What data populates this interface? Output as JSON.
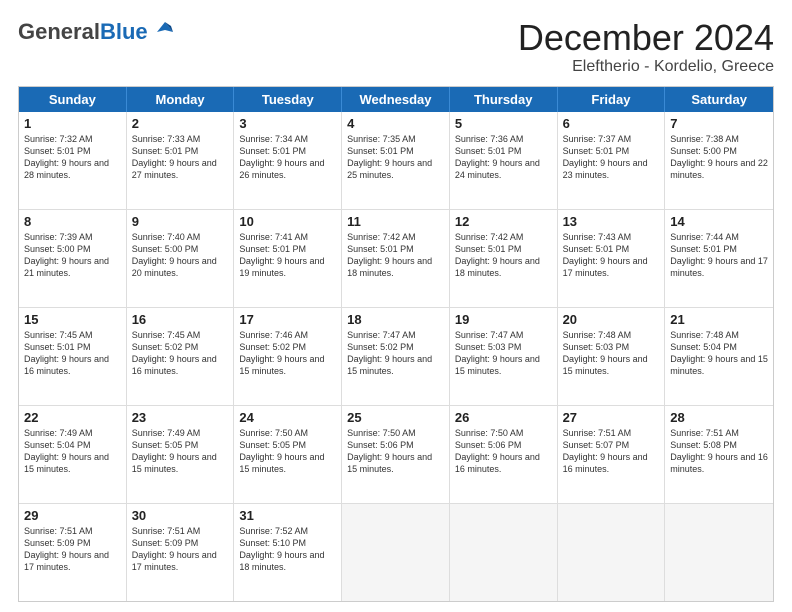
{
  "header": {
    "logo_general": "General",
    "logo_blue": "Blue",
    "title": "December 2024",
    "subtitle": "Eleftherio - Kordelio, Greece"
  },
  "calendar": {
    "days": [
      "Sunday",
      "Monday",
      "Tuesday",
      "Wednesday",
      "Thursday",
      "Friday",
      "Saturday"
    ],
    "rows": [
      [
        {
          "day": "1",
          "sunrise": "7:32 AM",
          "sunset": "5:01 PM",
          "daylight": "9 hours and 28 minutes."
        },
        {
          "day": "2",
          "sunrise": "7:33 AM",
          "sunset": "5:01 PM",
          "daylight": "9 hours and 27 minutes."
        },
        {
          "day": "3",
          "sunrise": "7:34 AM",
          "sunset": "5:01 PM",
          "daylight": "9 hours and 26 minutes."
        },
        {
          "day": "4",
          "sunrise": "7:35 AM",
          "sunset": "5:01 PM",
          "daylight": "9 hours and 25 minutes."
        },
        {
          "day": "5",
          "sunrise": "7:36 AM",
          "sunset": "5:01 PM",
          "daylight": "9 hours and 24 minutes."
        },
        {
          "day": "6",
          "sunrise": "7:37 AM",
          "sunset": "5:01 PM",
          "daylight": "9 hours and 23 minutes."
        },
        {
          "day": "7",
          "sunrise": "7:38 AM",
          "sunset": "5:00 PM",
          "daylight": "9 hours and 22 minutes."
        }
      ],
      [
        {
          "day": "8",
          "sunrise": "7:39 AM",
          "sunset": "5:00 PM",
          "daylight": "9 hours and 21 minutes."
        },
        {
          "day": "9",
          "sunrise": "7:40 AM",
          "sunset": "5:00 PM",
          "daylight": "9 hours and 20 minutes."
        },
        {
          "day": "10",
          "sunrise": "7:41 AM",
          "sunset": "5:01 PM",
          "daylight": "9 hours and 19 minutes."
        },
        {
          "day": "11",
          "sunrise": "7:42 AM",
          "sunset": "5:01 PM",
          "daylight": "9 hours and 18 minutes."
        },
        {
          "day": "12",
          "sunrise": "7:42 AM",
          "sunset": "5:01 PM",
          "daylight": "9 hours and 18 minutes."
        },
        {
          "day": "13",
          "sunrise": "7:43 AM",
          "sunset": "5:01 PM",
          "daylight": "9 hours and 17 minutes."
        },
        {
          "day": "14",
          "sunrise": "7:44 AM",
          "sunset": "5:01 PM",
          "daylight": "9 hours and 17 minutes."
        }
      ],
      [
        {
          "day": "15",
          "sunrise": "7:45 AM",
          "sunset": "5:01 PM",
          "daylight": "9 hours and 16 minutes."
        },
        {
          "day": "16",
          "sunrise": "7:45 AM",
          "sunset": "5:02 PM",
          "daylight": "9 hours and 16 minutes."
        },
        {
          "day": "17",
          "sunrise": "7:46 AM",
          "sunset": "5:02 PM",
          "daylight": "9 hours and 15 minutes."
        },
        {
          "day": "18",
          "sunrise": "7:47 AM",
          "sunset": "5:02 PM",
          "daylight": "9 hours and 15 minutes."
        },
        {
          "day": "19",
          "sunrise": "7:47 AM",
          "sunset": "5:03 PM",
          "daylight": "9 hours and 15 minutes."
        },
        {
          "day": "20",
          "sunrise": "7:48 AM",
          "sunset": "5:03 PM",
          "daylight": "9 hours and 15 minutes."
        },
        {
          "day": "21",
          "sunrise": "7:48 AM",
          "sunset": "5:04 PM",
          "daylight": "9 hours and 15 minutes."
        }
      ],
      [
        {
          "day": "22",
          "sunrise": "7:49 AM",
          "sunset": "5:04 PM",
          "daylight": "9 hours and 15 minutes."
        },
        {
          "day": "23",
          "sunrise": "7:49 AM",
          "sunset": "5:05 PM",
          "daylight": "9 hours and 15 minutes."
        },
        {
          "day": "24",
          "sunrise": "7:50 AM",
          "sunset": "5:05 PM",
          "daylight": "9 hours and 15 minutes."
        },
        {
          "day": "25",
          "sunrise": "7:50 AM",
          "sunset": "5:06 PM",
          "daylight": "9 hours and 15 minutes."
        },
        {
          "day": "26",
          "sunrise": "7:50 AM",
          "sunset": "5:06 PM",
          "daylight": "9 hours and 16 minutes."
        },
        {
          "day": "27",
          "sunrise": "7:51 AM",
          "sunset": "5:07 PM",
          "daylight": "9 hours and 16 minutes."
        },
        {
          "day": "28",
          "sunrise": "7:51 AM",
          "sunset": "5:08 PM",
          "daylight": "9 hours and 16 minutes."
        }
      ],
      [
        {
          "day": "29",
          "sunrise": "7:51 AM",
          "sunset": "5:09 PM",
          "daylight": "9 hours and 17 minutes."
        },
        {
          "day": "30",
          "sunrise": "7:51 AM",
          "sunset": "5:09 PM",
          "daylight": "9 hours and 17 minutes."
        },
        {
          "day": "31",
          "sunrise": "7:52 AM",
          "sunset": "5:10 PM",
          "daylight": "9 hours and 18 minutes."
        },
        null,
        null,
        null,
        null
      ]
    ]
  }
}
